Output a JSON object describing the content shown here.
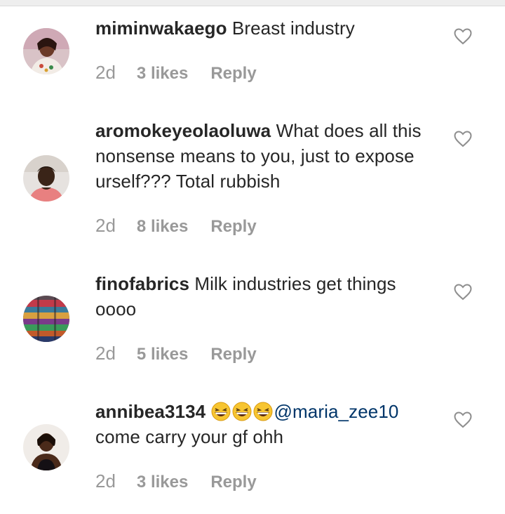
{
  "comments": [
    {
      "username": "miminwakaego",
      "text_before": " Breast industry",
      "mention": "",
      "text_after": "",
      "emojis": [],
      "time": "2d",
      "likes": "3 likes",
      "reply": "Reply"
    },
    {
      "username": "aromokeyeolaoluwa",
      "text_before": " What does all this nonsense means to you, just to expose urself??? Total rubbish",
      "mention": "",
      "text_after": "",
      "emojis": [],
      "time": "2d",
      "likes": "8 likes",
      "reply": "Reply"
    },
    {
      "username": "finofabrics",
      "text_before": " Milk industries get things oooo",
      "mention": "",
      "text_after": "",
      "emojis": [],
      "time": "2d",
      "likes": "5 likes",
      "reply": "Reply"
    },
    {
      "username": "annibea3134",
      "text_before": " ",
      "mention": "@maria_zee10",
      "text_after": " come carry your gf ohh",
      "emojis": [
        "grinning-squinting-face-emoji",
        "grinning-squinting-face-emoji",
        "grinning-squinting-face-emoji"
      ],
      "time": "2d",
      "likes": "3 likes",
      "reply": "Reply"
    }
  ],
  "icons": {
    "like": "heart-outline-icon"
  },
  "colors": {
    "text": "#262626",
    "meta": "#999999",
    "mention": "#003569",
    "heart_stroke": "#8e8e8e"
  }
}
